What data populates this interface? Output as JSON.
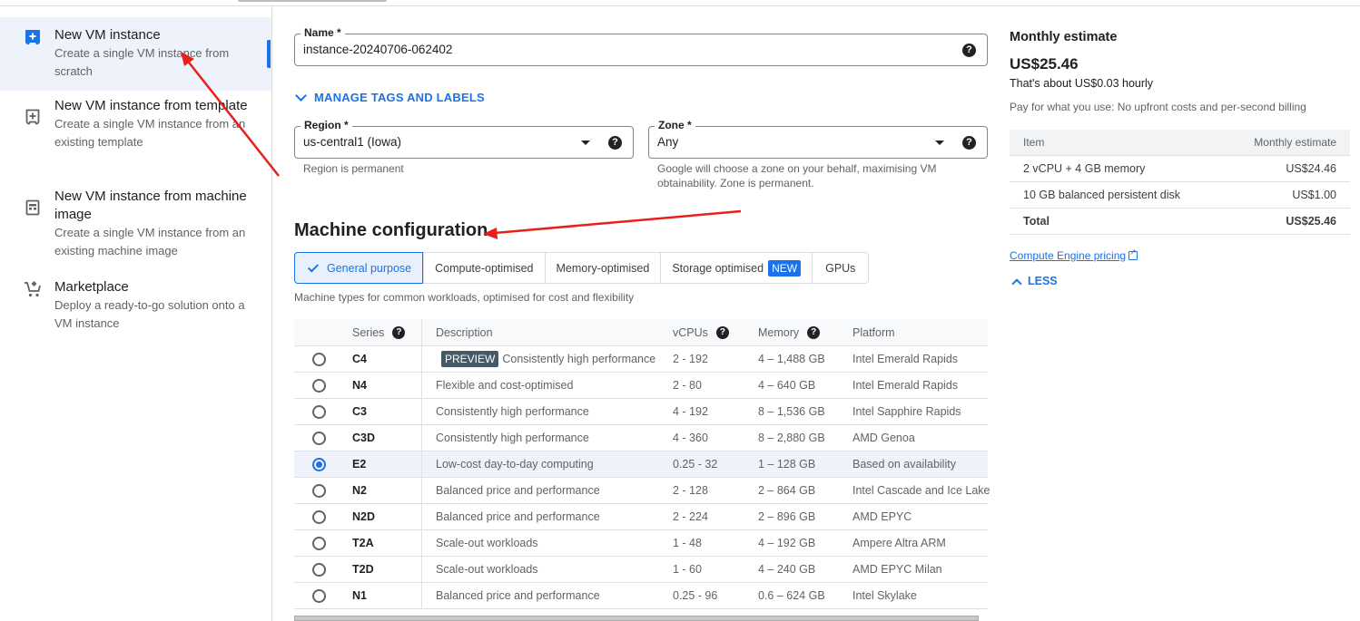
{
  "sidebar": {
    "items": [
      {
        "title": "New VM instance",
        "subtitle": "Create a single VM instance from scratch",
        "icon": "add-box-filled-icon",
        "active": true
      },
      {
        "title": "New VM instance from template",
        "subtitle": "Create a single VM instance from an existing template",
        "icon": "add-box-outline-icon",
        "active": false
      },
      {
        "title": "New VM instance from machine image",
        "subtitle": "Create a single VM instance from an existing machine image",
        "icon": "machine-image-icon",
        "active": false
      },
      {
        "title": "Marketplace",
        "subtitle": "Deploy a ready-to-go solution onto a VM instance",
        "icon": "marketplace-cart-icon",
        "active": false
      }
    ]
  },
  "form": {
    "name": {
      "label": "Name *",
      "value": "instance-20240706-062402"
    },
    "manage_tags_label": "MANAGE TAGS AND LABELS",
    "region": {
      "label": "Region *",
      "value": "us-central1 (Iowa)",
      "hint": "Region is permanent"
    },
    "zone": {
      "label": "Zone *",
      "value": "Any",
      "hint": "Google will choose a zone on your behalf, maximising VM obtainability. Zone is permanent."
    },
    "help_glyph": "?"
  },
  "machine_config": {
    "title": "Machine configuration",
    "tabs": [
      {
        "label": "General purpose",
        "active": true
      },
      {
        "label": "Compute-optimised",
        "active": false
      },
      {
        "label": "Memory-optimised",
        "active": false
      },
      {
        "label": "Storage optimised",
        "badge": "NEW",
        "active": false
      },
      {
        "label": "GPUs",
        "active": false
      }
    ],
    "tab_description": "Machine types for common workloads, optimised for cost and flexibility",
    "columns": {
      "series": "Series",
      "description": "Description",
      "vcpus": "vCPUs",
      "memory": "Memory",
      "platform": "Platform"
    },
    "rows": [
      {
        "series": "C4",
        "badge": "PREVIEW",
        "description": "Consistently high performance",
        "vcpus": "2 - 192",
        "memory": "4 – 1,488 GB",
        "platform": "Intel Emerald Rapids",
        "selected": false
      },
      {
        "series": "N4",
        "description": "Flexible and cost-optimised",
        "vcpus": "2 - 80",
        "memory": "4 – 640 GB",
        "platform": "Intel Emerald Rapids",
        "selected": false
      },
      {
        "series": "C3",
        "description": "Consistently high performance",
        "vcpus": "4 - 192",
        "memory": "8 – 1,536 GB",
        "platform": "Intel Sapphire Rapids",
        "selected": false
      },
      {
        "series": "C3D",
        "description": "Consistently high performance",
        "vcpus": "4 - 360",
        "memory": "8 – 2,880 GB",
        "platform": "AMD Genoa",
        "selected": false
      },
      {
        "series": "E2",
        "description": "Low-cost day-to-day computing",
        "vcpus": "0.25 - 32",
        "memory": "1 – 128 GB",
        "platform": "Based on availability",
        "selected": true
      },
      {
        "series": "N2",
        "description": "Balanced price and performance",
        "vcpus": "2 - 128",
        "memory": "2 – 864 GB",
        "platform": "Intel Cascade and Ice Lake",
        "selected": false
      },
      {
        "series": "N2D",
        "description": "Balanced price and performance",
        "vcpus": "2 - 224",
        "memory": "2 – 896 GB",
        "platform": "AMD EPYC",
        "selected": false
      },
      {
        "series": "T2A",
        "description": "Scale-out workloads",
        "vcpus": "1 - 48",
        "memory": "4 – 192 GB",
        "platform": "Ampere Altra ARM",
        "selected": false
      },
      {
        "series": "T2D",
        "description": "Scale-out workloads",
        "vcpus": "1 - 60",
        "memory": "4 – 240 GB",
        "platform": "AMD EPYC Milan",
        "selected": false
      },
      {
        "series": "N1",
        "description": "Balanced price and performance",
        "vcpus": "0.25 - 96",
        "memory": "0.6 – 624 GB",
        "platform": "Intel Skylake",
        "selected": false
      }
    ]
  },
  "estimate": {
    "title": "Monthly estimate",
    "amount": "US$25.46",
    "hourly": "That's about US$0.03 hourly",
    "pay_note": "Pay for what you use: No upfront costs and per-second billing",
    "table_head": {
      "item": "Item",
      "estimate": "Monthly estimate"
    },
    "items": [
      {
        "item": "2 vCPU + 4 GB memory",
        "cost": "US$24.46"
      },
      {
        "item": "10 GB balanced persistent disk",
        "cost": "US$1.00"
      }
    ],
    "total": {
      "item": "Total",
      "cost": "US$25.46"
    },
    "pricing_link": "Compute Engine pricing",
    "less_label": "LESS"
  },
  "colors": {
    "accent": "#1a73e8",
    "annotation": "#e8201c"
  }
}
